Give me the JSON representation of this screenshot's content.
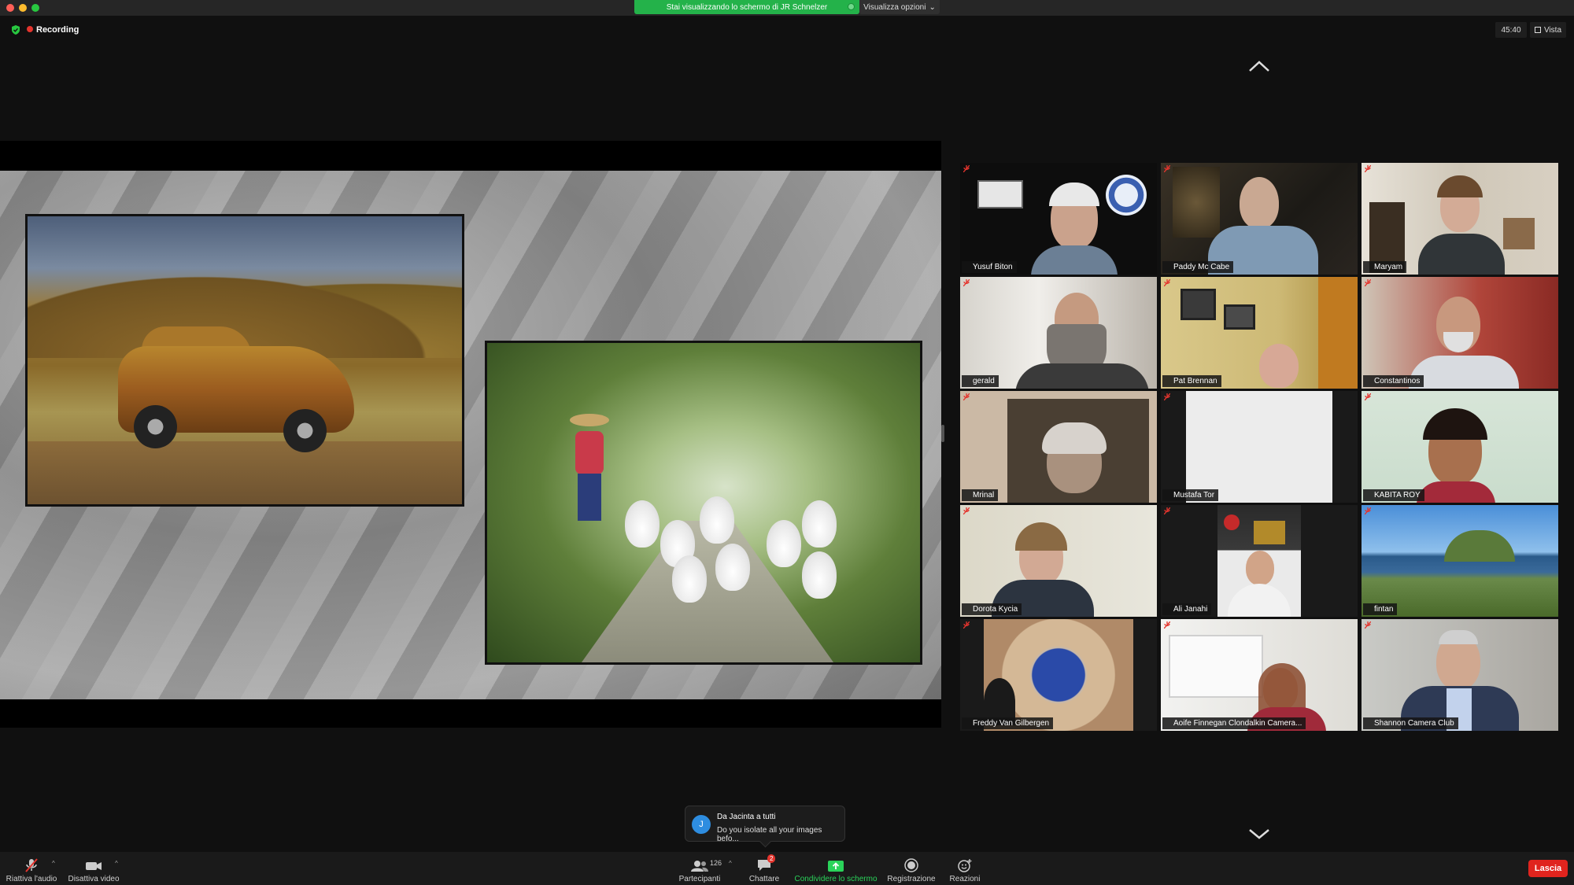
{
  "top": {
    "share_banner": "Stai visualizzando lo schermo di JR Schnelzer",
    "view_options": "Visualizza opzioni",
    "recording": "Recording",
    "timer": "45:40",
    "view": "Vista"
  },
  "participants": [
    {
      "name": "Yusuf Biton"
    },
    {
      "name": "Paddy Mc Cabe"
    },
    {
      "name": "Maryam"
    },
    {
      "name": "gerald"
    },
    {
      "name": "Pat Brennan"
    },
    {
      "name": "Constantinos"
    },
    {
      "name": "Mrinal"
    },
    {
      "name": "Mustafa Tor"
    },
    {
      "name": "KABITA ROY"
    },
    {
      "name": "Dorota Kycia"
    },
    {
      "name": "Ali Janahi"
    },
    {
      "name": "fintan"
    },
    {
      "name": "Freddy Van Gilbergen"
    },
    {
      "name": "Aoife Finnegan Clondalkin Camera..."
    },
    {
      "name": "Shannon Camera Club"
    }
  ],
  "chat_toast": {
    "avatar_letter": "J",
    "from": "Da Jacinta  a tutti",
    "message": "Do you isolate all your images befo..."
  },
  "toolbar": {
    "unmute": "Riattiva l'audio",
    "stop_video": "Disattiva video",
    "participants": "Partecipanti",
    "participants_count": "126",
    "chat": "Chattare",
    "chat_badge": "2",
    "share": "Condividere lo schermo",
    "record": "Registrazione",
    "reactions": "Reazioni",
    "leave": "Lascia"
  },
  "colors": {
    "share_green": "#24b24a",
    "leave_red": "#e0241e",
    "recording_red": "#e4342d"
  }
}
